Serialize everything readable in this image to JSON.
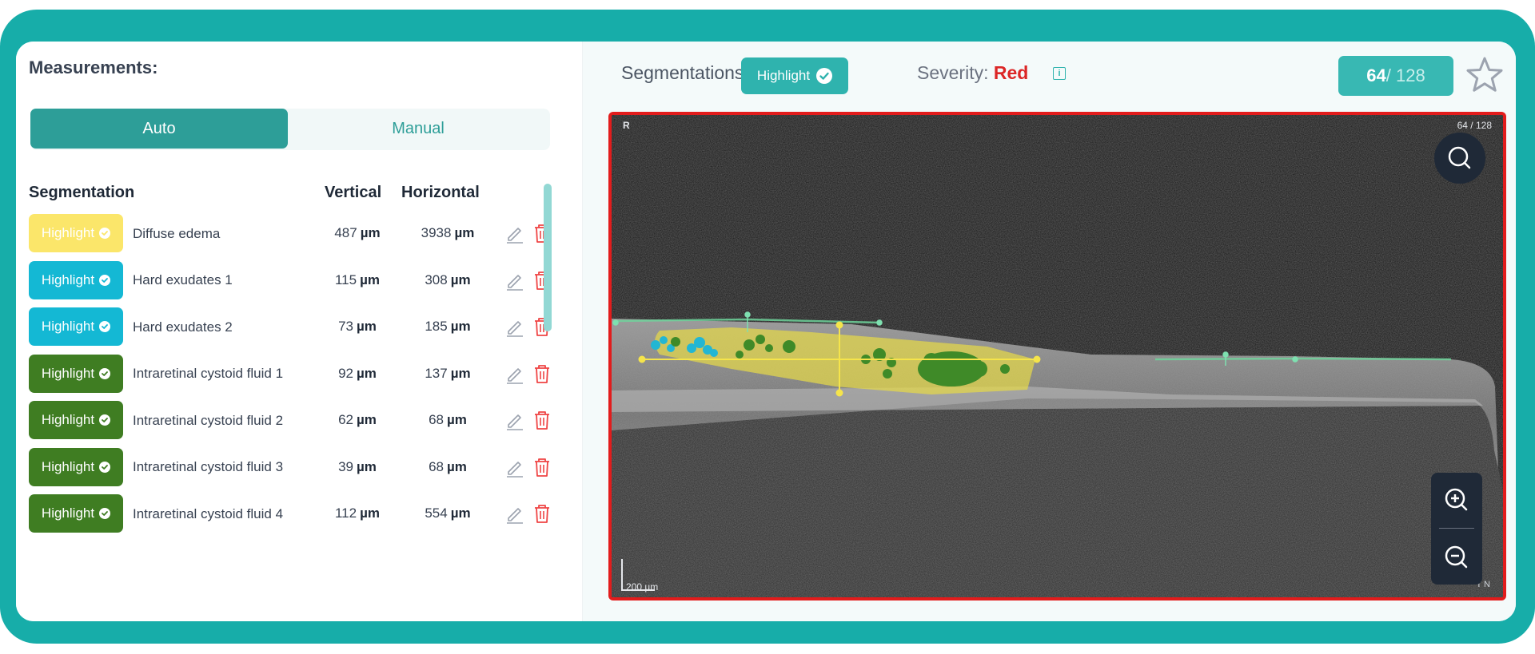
{
  "measurements": {
    "title": "Measurements:",
    "tabs": {
      "auto": "Auto",
      "manual": "Manual",
      "active": "Auto"
    },
    "columns": {
      "segmentation": "Segmentation",
      "vertical": "Vertical",
      "horizontal": "Horizontal"
    },
    "unit": "µm",
    "rows": [
      {
        "badge": "Highlight",
        "color": "#fbe66a",
        "name": "Diffuse edema",
        "vertical": "487",
        "horizontal": "3938"
      },
      {
        "badge": "Highlight",
        "color": "#14b8d4",
        "name": "Hard exudates 1",
        "vertical": "115",
        "horizontal": "308"
      },
      {
        "badge": "Highlight",
        "color": "#14b8d4",
        "name": "Hard exudates 2",
        "vertical": "73",
        "horizontal": "185"
      },
      {
        "badge": "Highlight",
        "color": "#3f7d22",
        "name": "Intraretinal cystoid fluid 1",
        "vertical": "92",
        "horizontal": "137"
      },
      {
        "badge": "Highlight",
        "color": "#3f7d22",
        "name": "Intraretinal cystoid fluid 2",
        "vertical": "62",
        "horizontal": "68"
      },
      {
        "badge": "Highlight",
        "color": "#3f7d22",
        "name": "Intraretinal cystoid fluid 3",
        "vertical": "39",
        "horizontal": "68"
      },
      {
        "badge": "Highlight",
        "color": "#3f7d22",
        "name": "Intraretinal cystoid fluid 4",
        "vertical": "112",
        "horizontal": "554"
      }
    ]
  },
  "viewer": {
    "segmentations_label": "Segmentations:",
    "segmentations_badge": "Highlight",
    "severity_label": "Severity:",
    "severity_value": "Red",
    "slice_current": "64",
    "slice_total": "/ 128",
    "scan_corner_left": "R",
    "scan_corner_right": "64 / 128",
    "scale_label": "200 µm",
    "orientation_label": "T         N",
    "icons": [
      "star-icon",
      "search-icon",
      "zoom-in-icon",
      "zoom-out-icon",
      "info-icon",
      "edit-icon",
      "trash-icon",
      "check-icon"
    ],
    "colors": {
      "accent": "#17ada9",
      "severity": "#dc2626",
      "edema": "#fbe66a",
      "exudate": "#14b8d4",
      "fluid": "#3f7d22"
    }
  }
}
